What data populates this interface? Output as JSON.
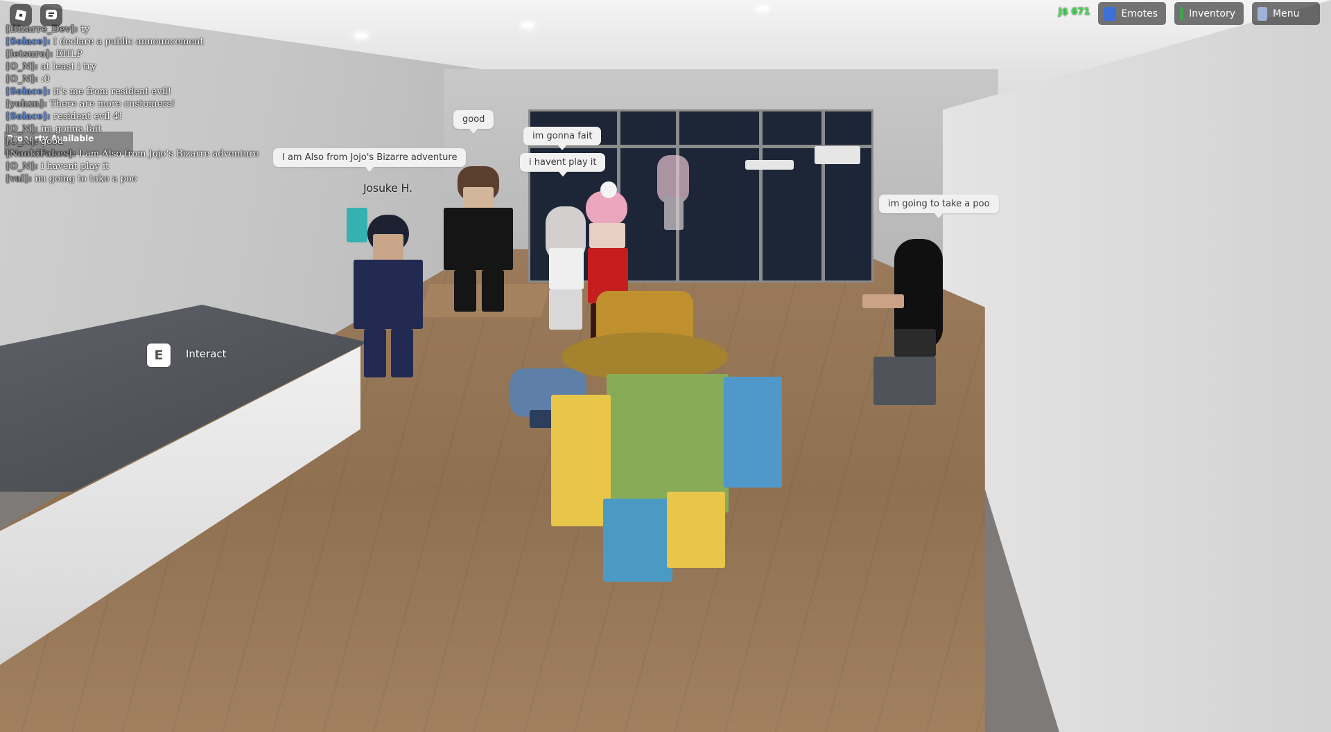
{
  "chat": {
    "lines": [
      {
        "speaker": "[Bizarre_Dev]:",
        "message": "ty",
        "color": "#9a9a9a"
      },
      {
        "speaker": "[Solace]:",
        "message": "I declare a public announcement",
        "color": "#5b86d6"
      },
      {
        "speaker": "[letsuro]:",
        "message": "EHLP",
        "color": "#9a9a9a"
      },
      {
        "speaker": "[O_N]:",
        "message": "at least i try",
        "color": "#9a9a9a"
      },
      {
        "speaker": "[O_N]:",
        "message": ":0",
        "color": "#9a9a9a"
      },
      {
        "speaker": "[Solace]:",
        "message": "it's me from resident evil!",
        "color": "#5b86d6"
      },
      {
        "speaker": "[yohxn]:",
        "message": "There are more customers!",
        "color": "#9a9a9a"
      },
      {
        "speaker": "[Solace]:",
        "message": "resident evil 4!",
        "color": "#5b86d6"
      },
      {
        "speaker": "[O_N]:",
        "message": "im gonna fait",
        "color": "#9a9a9a"
      },
      {
        "speaker": "[O_N]:",
        "message": "good",
        "color": "#9a9a9a"
      },
      {
        "speaker": "[NaokiFakes]:",
        "message": "I am Also from Jojo's Bizarre adventure",
        "color": "#9a9a9a"
      },
      {
        "speaker": "[O_N]:",
        "message": "i havent play it",
        "color": "#9a9a9a"
      },
      {
        "speaker": "[val]:",
        "message": "im going to take a poo",
        "color": "#9a9a9a"
      }
    ],
    "property_banner": "Property Available"
  },
  "topbar": {
    "currency": "J$ 671",
    "emotes_label": "Emotes",
    "inventory_label": "Inventory",
    "menu_label": "Menu"
  },
  "bubbles": {
    "jojo": "I am Also from Jojo's Bizarre adventure",
    "good": "good",
    "gonna_fait": "im gonna fait",
    "havent_play": "i havent play it",
    "poo": "im going to take a poo"
  },
  "nametag": "Josuke H.",
  "interact": {
    "key": "E",
    "label": "Interact"
  },
  "colors": {
    "accent_green": "#39e64a",
    "solace_blue": "#5b86d6",
    "emotes_icon": "#3d6fd9",
    "inventory_icon": "#3fa34a",
    "menu_icon": "#9fb3d9"
  }
}
